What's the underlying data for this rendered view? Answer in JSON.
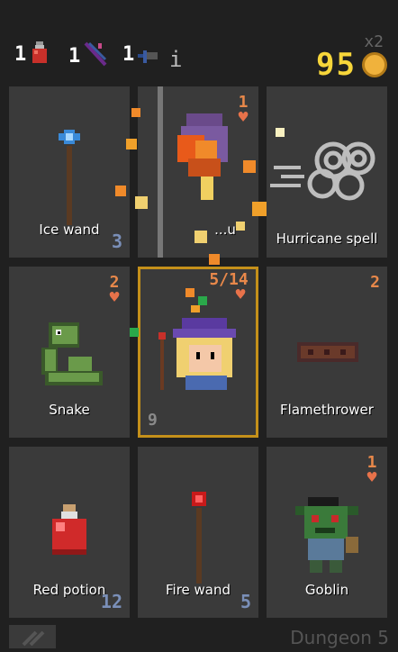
{
  "hud": {
    "items": [
      {
        "count": "1",
        "icon": "potion-icon"
      },
      {
        "count": "1",
        "icon": "scroll-icon"
      },
      {
        "count": "1",
        "icon": "arrow-icon"
      }
    ],
    "info": "i",
    "multiplier": "x2",
    "gold": "95"
  },
  "cards": [
    {
      "name": "Ice wand",
      "count": "3",
      "icon": "ice-wand-icon"
    },
    {
      "name": "...u",
      "hp": "1",
      "icon": "burning-enemy-icon"
    },
    {
      "name": "Hurricane spell",
      "icon": "hurricane-icon"
    },
    {
      "name": "Snake",
      "hp": "2",
      "icon": "snake-icon"
    },
    {
      "hp": "5/14",
      "level": "9",
      "icon": "wizard-hero-icon"
    },
    {
      "name": "Flamethrower",
      "hp": "2",
      "icon": "flamethrower-icon"
    },
    {
      "name": "Red potion",
      "count": "12",
      "icon": "red-potion-icon"
    },
    {
      "name": "Fire wand",
      "count": "5",
      "icon": "fire-wand-icon"
    },
    {
      "name": "Goblin",
      "hp": "1",
      "icon": "goblin-icon"
    }
  ],
  "footer": {
    "dungeon": "Dungeon 5"
  },
  "colors": {
    "background": "#202020",
    "card": "#3a3a3a",
    "hero_border": "#c4901a",
    "gold": "#f7d63a",
    "heart": "#e8724a"
  }
}
